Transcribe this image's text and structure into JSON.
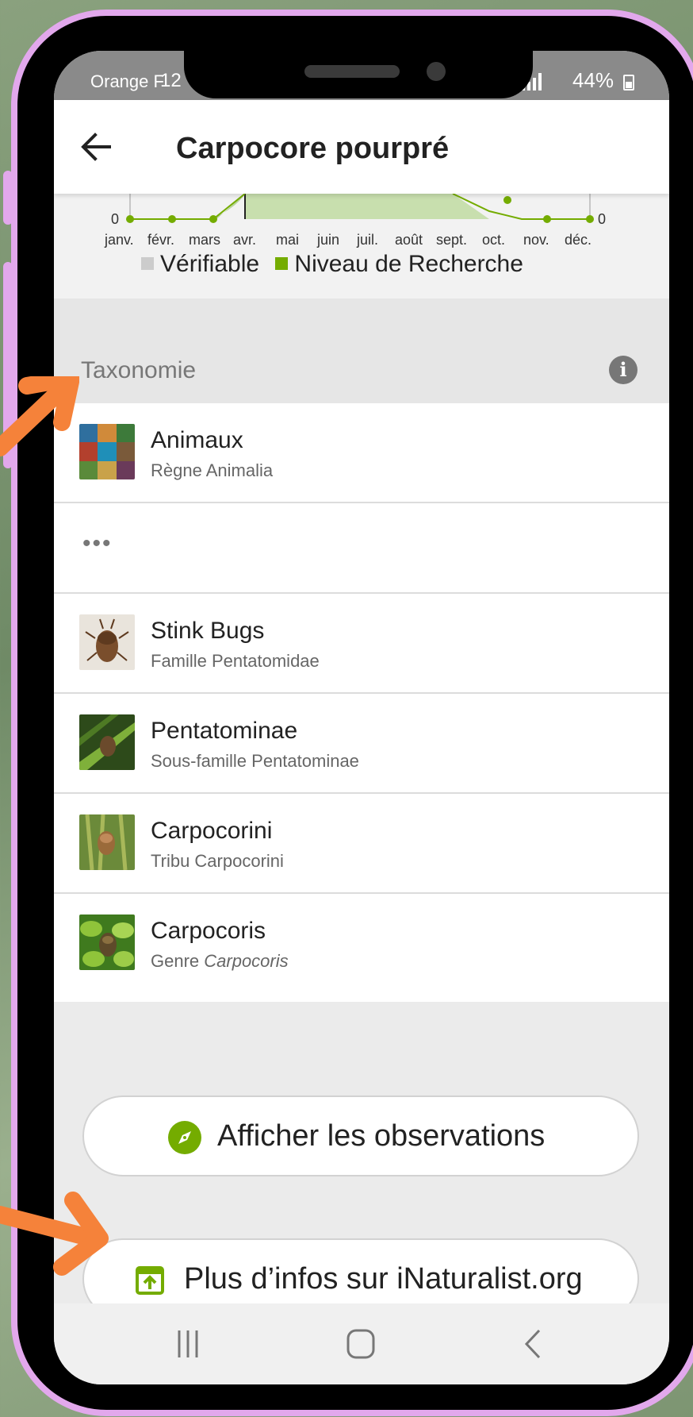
{
  "status_bar": {
    "carrier": "Orange F",
    "time": "12",
    "battery": "44%"
  },
  "header": {
    "title": "Carpocore pourpré"
  },
  "seasonality_chart": {
    "y_min_label_left": "0",
    "y_min_label_right": "0",
    "months": [
      "janv.",
      "févr.",
      "mars",
      "avr.",
      "mai",
      "juin",
      "juil.",
      "août",
      "sept.",
      "oct.",
      "nov.",
      "déc."
    ],
    "legend": [
      {
        "label": "Vérifiable",
        "color": "#cccccc"
      },
      {
        "label": "Niveau de Recherche",
        "color": "#74ac00"
      }
    ]
  },
  "taxonomy": {
    "title": "Taxonomie",
    "ellipsis": "•••",
    "items": [
      {
        "name": "Animaux",
        "rank": "Règne Animalia",
        "rank_italic": ""
      },
      {
        "name": "Stink Bugs",
        "rank": "Famille Pentatomidae",
        "rank_italic": ""
      },
      {
        "name": "Pentatominae",
        "rank": "Sous-famille Pentatominae",
        "rank_italic": ""
      },
      {
        "name": "Carpocorini",
        "rank": "Tribu Carpocorini",
        "rank_italic": ""
      },
      {
        "name": "Carpocoris",
        "rank": "Genre ",
        "rank_italic": "Carpocoris"
      }
    ]
  },
  "actions": {
    "observations_label": "Afficher les observations",
    "more_info_label": "Plus d’infos sur iNaturalist.org"
  },
  "colors": {
    "accent": "#74ac00",
    "frame": "#e2a8ec",
    "annotation_arrow": "#f5823a"
  }
}
